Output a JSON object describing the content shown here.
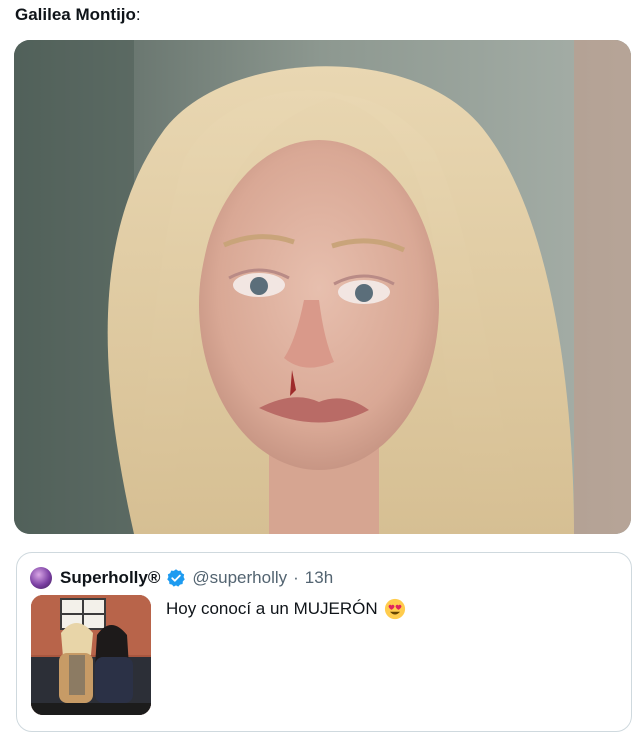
{
  "caption": {
    "author": "Galilea Montijo",
    "colon": ":"
  },
  "main_media": {
    "alt": "photo"
  },
  "quoted_tweet": {
    "display_name": "Superholly®",
    "handle": "@superholly",
    "separator": "·",
    "time": "13h",
    "text": "Hoy conocí a un MUJERÓN",
    "emoji": "heart-eyes-emoji",
    "verified": true
  },
  "colors": {
    "verified_blue": "#1d9bf0",
    "text_primary": "#0f1419",
    "text_secondary": "#536471",
    "border": "#cfd9de"
  }
}
